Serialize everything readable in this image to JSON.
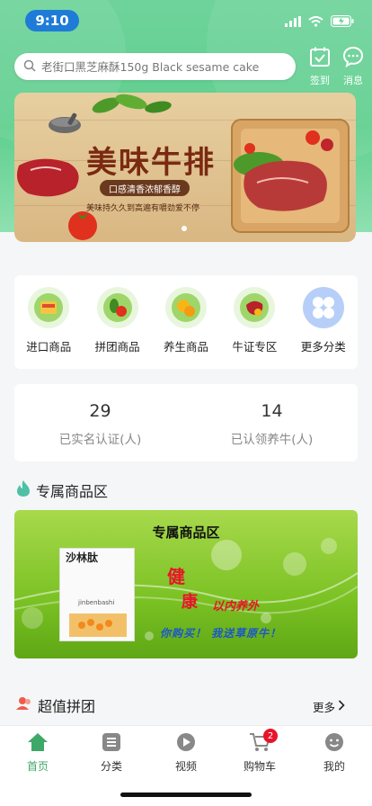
{
  "status": {
    "time": "9:10"
  },
  "search": {
    "placeholder": "老街口黑芝麻酥150g Black sesame cake"
  },
  "top_actions": {
    "checkin": "签到",
    "messages": "消息"
  },
  "banner": {
    "title": "美味牛排",
    "subtitle": "口感清香浓郁香醇",
    "line": "美味持久久到高遍有嚼劲爱不停"
  },
  "categories": [
    {
      "label": "进口商品",
      "icon": "imported-goods-icon"
    },
    {
      "label": "拼团商品",
      "icon": "group-buy-icon"
    },
    {
      "label": "养生商品",
      "icon": "wellness-icon"
    },
    {
      "label": "牛证专区",
      "icon": "beef-zone-icon"
    },
    {
      "label": "更多分类",
      "icon": "more-categories-icon"
    }
  ],
  "stats": [
    {
      "value": "29",
      "label": "已实名认证(人)"
    },
    {
      "value": "14",
      "label": "已认领养牛(人)"
    }
  ],
  "exclusive": {
    "section_title": "专属商品区",
    "promo_title": "专属商品区",
    "product_name": "沙林肽",
    "product_brand": "jinbenbashi",
    "big1": "健",
    "big2": "康",
    "tag": "以内养外",
    "slogan": "你购买！ 我送草原牛！"
  },
  "group": {
    "section_title": "超值拼团",
    "more": "更多"
  },
  "tabbar": {
    "items": [
      {
        "label": "首页"
      },
      {
        "label": "分类"
      },
      {
        "label": "视频"
      },
      {
        "label": "购物车"
      },
      {
        "label": "我的"
      }
    ],
    "cart_badge": "2"
  },
  "colors": {
    "brand_green": "#5fcf8e",
    "active_tab": "#3ea868",
    "badge_red": "#e8142a"
  }
}
